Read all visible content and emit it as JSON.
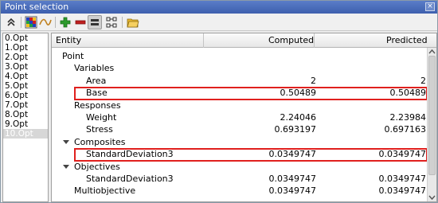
{
  "window": {
    "title": "Point selection",
    "close_glyph": "×"
  },
  "toolbar": {
    "icons": [
      "collapse-icon",
      "heatmap-icon",
      "curve-icon",
      "add-icon",
      "remove-icon",
      "equal-icon",
      "grid-icon",
      "export-icon"
    ],
    "accent_add": "#2c9a2c",
    "accent_remove": "#c02020"
  },
  "points": [
    "0.Opt",
    "1.Opt",
    "2.Opt",
    "3.Opt",
    "4.Opt",
    "5.Opt",
    "6.Opt",
    "7.Opt",
    "8.Opt",
    "9.Opt",
    "10.Opt"
  ],
  "selected_point": "10.Opt",
  "table": {
    "headers": {
      "entity": "Entity",
      "computed": "Computed",
      "predicted": "Predicted"
    },
    "rows": {
      "point": {
        "label": "Point"
      },
      "variables": {
        "label": "Variables"
      },
      "area": {
        "label": "Area",
        "computed": "2",
        "predicted": "2"
      },
      "base": {
        "label": "Base",
        "computed": "0.50489",
        "predicted": "0.50489"
      },
      "responses": {
        "label": "Responses"
      },
      "weight": {
        "label": "Weight",
        "computed": "2.24046",
        "predicted": "2.23984"
      },
      "stress": {
        "label": "Stress",
        "computed": "0.693197",
        "predicted": "0.697163"
      },
      "composites": {
        "label": "Composites"
      },
      "stddev_comp": {
        "label": "StandardDeviation3",
        "computed": "0.0349747",
        "predicted": "0.0349747"
      },
      "objectives": {
        "label": "Objectives"
      },
      "stddev_obj": {
        "label": "StandardDeviation3",
        "computed": "0.0349747",
        "predicted": "0.0349747"
      },
      "multiobjective": {
        "label": "Multiobjective",
        "computed": "0.0349747",
        "predicted": "0.0349747"
      }
    }
  },
  "highlight_color": "#e0201e"
}
